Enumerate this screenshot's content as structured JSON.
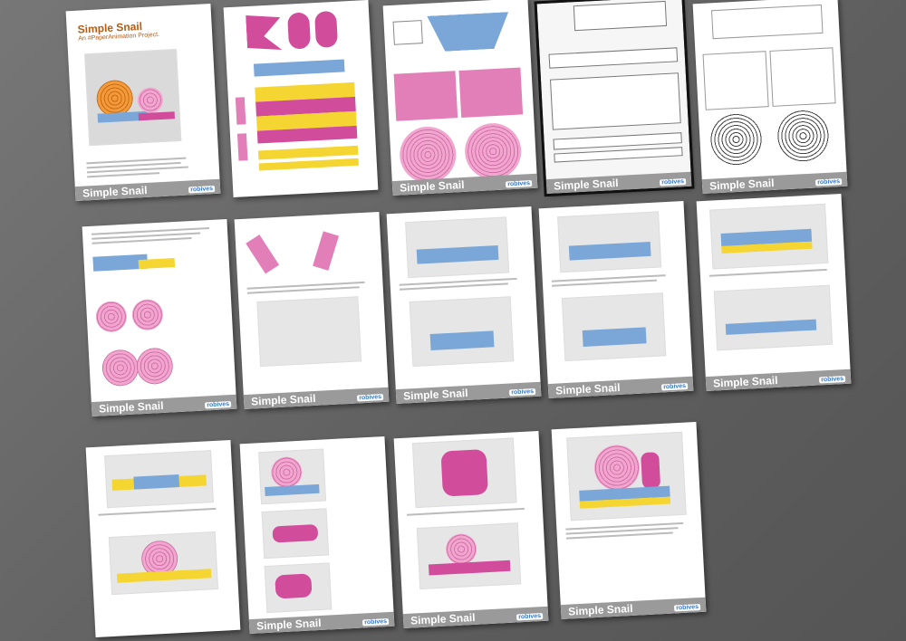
{
  "footer_title": "Simple Snail",
  "brand": "robives",
  "cover": {
    "title": "Simple Snail",
    "subtitle": "An #PaperAnimation Project."
  },
  "pages": [
    {
      "id": "cover"
    },
    {
      "id": "parts-1"
    },
    {
      "id": "parts-2"
    },
    {
      "id": "parts-3"
    },
    {
      "id": "parts-4"
    },
    {
      "id": "step-1"
    },
    {
      "id": "step-2"
    },
    {
      "id": "step-3"
    },
    {
      "id": "step-4"
    },
    {
      "id": "step-5"
    },
    {
      "id": "step-6"
    },
    {
      "id": "step-7"
    },
    {
      "id": "step-8"
    },
    {
      "id": "step-9"
    }
  ],
  "colors": {
    "background": "#6c6c6c",
    "footer": "#9a9a9a",
    "cover_title": "#b85a10",
    "pink": "#e37fb8",
    "magenta": "#d24c9c",
    "yellow": "#f4d531",
    "blue": "#7aa7d8"
  }
}
